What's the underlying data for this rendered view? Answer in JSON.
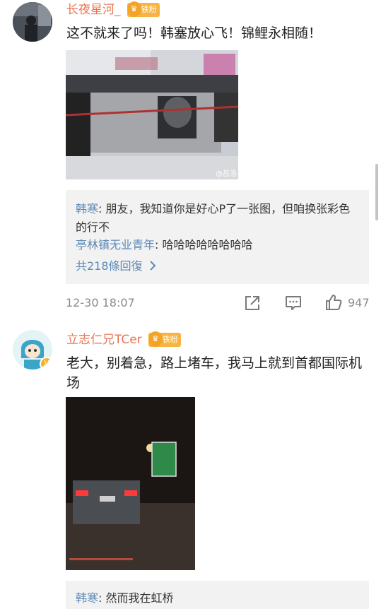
{
  "comments": [
    {
      "username": "长夜星河_",
      "badge": "铁粉",
      "text": "这不就来了吗！韩塞放心飞！锦鲤永相随！",
      "image_watermark": "@吕洛",
      "replies": [
        {
          "name": "韩寒",
          "sep": ": ",
          "text": "朋友，我知道你是好心P了一张图，但咱换张彩色的行不"
        },
        {
          "name": "亭林镇无业青年",
          "sep": ": ",
          "text": "哈哈哈哈哈哈哈哈"
        }
      ],
      "more_replies": "共218條回復",
      "timestamp": "12-30 18:07",
      "like_count": "947"
    },
    {
      "username": "立志仁兄TCer",
      "badge": "铁粉",
      "text": "老大，别着急，路上堵车，我马上就到首都国际机场",
      "replies": [
        {
          "name": "韩寒",
          "sep": ": ",
          "text": "然而我在虹桥"
        }
      ]
    }
  ],
  "colors": {
    "username": "#eb7350",
    "reply_name": "#5b8ab7",
    "badge": "#f7b440",
    "reply_bg": "#f2f2f2",
    "meta": "#8b8b8b"
  },
  "icons": {
    "share": "share-icon",
    "comment": "comment-icon",
    "like": "thumbs-up-icon",
    "crown": "crown-icon",
    "chevron": "chevron-right-icon"
  }
}
